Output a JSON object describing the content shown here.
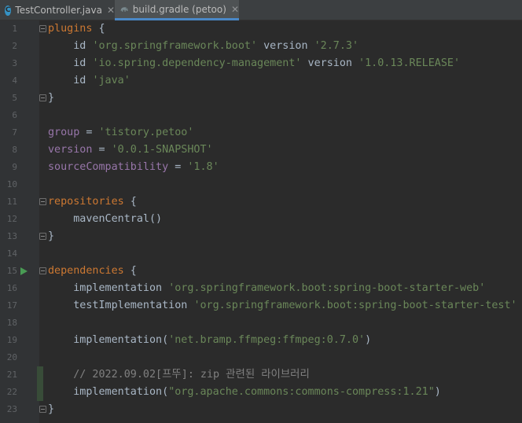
{
  "tabs": [
    {
      "label": "TestController.java",
      "icon": "java-class-icon",
      "active": false
    },
    {
      "label": "build.gradle (petoo)",
      "icon": "gradle-elephant-icon",
      "active": true
    }
  ],
  "colors": {
    "background": "#2b2b2b",
    "keyword": "#cc7832",
    "string": "#6a8759",
    "property": "#9876aa",
    "comment": "#808080",
    "text": "#a9b7c6",
    "active_tab_underline": "#4a88c7",
    "run_arrow": "#499c54"
  },
  "lines": [
    {
      "n": "1",
      "tokens": [
        {
          "t": "plugins",
          "c": "kw"
        },
        {
          "t": " {",
          "c": "txt"
        }
      ]
    },
    {
      "n": "2",
      "tokens": [
        {
          "t": "    id ",
          "c": "txt"
        },
        {
          "t": "'org.springframework.boot'",
          "c": "str"
        },
        {
          "t": " version ",
          "c": "txt"
        },
        {
          "t": "'2.7.3'",
          "c": "str"
        }
      ]
    },
    {
      "n": "3",
      "tokens": [
        {
          "t": "    id ",
          "c": "txt"
        },
        {
          "t": "'io.spring.dependency-management'",
          "c": "str"
        },
        {
          "t": " version ",
          "c": "txt"
        },
        {
          "t": "'1.0.13.RELEASE'",
          "c": "str"
        }
      ]
    },
    {
      "n": "4",
      "tokens": [
        {
          "t": "    id ",
          "c": "txt"
        },
        {
          "t": "'java'",
          "c": "str"
        }
      ]
    },
    {
      "n": "5",
      "tokens": [
        {
          "t": "}",
          "c": "txt"
        }
      ]
    },
    {
      "n": "6",
      "tokens": []
    },
    {
      "n": "7",
      "tokens": [
        {
          "t": "group",
          "c": "prop"
        },
        {
          "t": " = ",
          "c": "txt"
        },
        {
          "t": "'tistory.petoo'",
          "c": "str"
        }
      ]
    },
    {
      "n": "8",
      "tokens": [
        {
          "t": "version",
          "c": "prop"
        },
        {
          "t": " = ",
          "c": "txt"
        },
        {
          "t": "'0.0.1-SNAPSHOT'",
          "c": "str"
        }
      ]
    },
    {
      "n": "9",
      "tokens": [
        {
          "t": "sourceCompatibility",
          "c": "prop"
        },
        {
          "t": " = ",
          "c": "txt"
        },
        {
          "t": "'1.8'",
          "c": "str"
        }
      ]
    },
    {
      "n": "10",
      "tokens": []
    },
    {
      "n": "11",
      "tokens": [
        {
          "t": "repositories",
          "c": "kw"
        },
        {
          "t": " {",
          "c": "txt"
        }
      ]
    },
    {
      "n": "12",
      "tokens": [
        {
          "t": "    mavenCentral()",
          "c": "txt"
        }
      ]
    },
    {
      "n": "13",
      "tokens": [
        {
          "t": "}",
          "c": "txt"
        }
      ]
    },
    {
      "n": "14",
      "tokens": []
    },
    {
      "n": "15",
      "tokens": [
        {
          "t": "dependencies",
          "c": "kw"
        },
        {
          "t": " {",
          "c": "txt"
        }
      ]
    },
    {
      "n": "16",
      "tokens": [
        {
          "t": "    implementation ",
          "c": "txt"
        },
        {
          "t": "'org.springframework.boot:spring-boot-starter-web'",
          "c": "str"
        }
      ]
    },
    {
      "n": "17",
      "tokens": [
        {
          "t": "    testImplementation ",
          "c": "txt"
        },
        {
          "t": "'org.springframework.boot:spring-boot-starter-test'",
          "c": "str"
        }
      ]
    },
    {
      "n": "18",
      "tokens": []
    },
    {
      "n": "19",
      "tokens": [
        {
          "t": "    implementation(",
          "c": "txt"
        },
        {
          "t": "'net.bramp.ffmpeg:ffmpeg:0.7.0'",
          "c": "str"
        },
        {
          "t": ")",
          "c": "txt"
        }
      ]
    },
    {
      "n": "20",
      "tokens": []
    },
    {
      "n": "21",
      "tokens": [
        {
          "t": "    // 2022.09.02[프뚜]: zip 관련된 라이브러리",
          "c": "com"
        }
      ]
    },
    {
      "n": "22",
      "tokens": [
        {
          "t": "    implementation(",
          "c": "txt"
        },
        {
          "t": "\"org.apache.commons:commons-compress:1.21\"",
          "c": "str"
        },
        {
          "t": ")",
          "c": "txt"
        }
      ]
    },
    {
      "n": "23",
      "tokens": [
        {
          "t": "}",
          "c": "txt"
        }
      ]
    }
  ]
}
